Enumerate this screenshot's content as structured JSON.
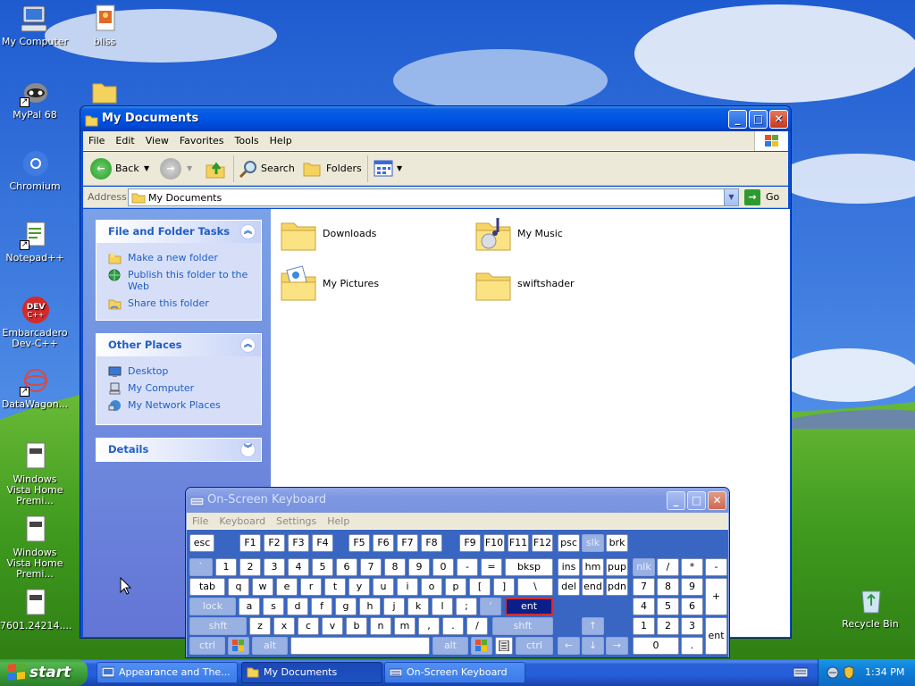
{
  "desktop": {
    "icons": [
      {
        "label": "My Computer"
      },
      {
        "label": "bliss"
      },
      {
        "label": "MyPal 68"
      },
      {
        "label": "Chromium"
      },
      {
        "label": "Notepad++"
      },
      {
        "label": "Embarcadero Dev-C++"
      },
      {
        "label": "DataWagon..."
      },
      {
        "label": "Windows Vista Home Premi..."
      },
      {
        "label": "Windows Vista Home Premi..."
      },
      {
        "label": "7601.24214...."
      },
      {
        "label": "Recycle Bin"
      }
    ]
  },
  "explorer": {
    "title": "My Documents",
    "menu": [
      "File",
      "Edit",
      "View",
      "Favorites",
      "Tools",
      "Help"
    ],
    "toolbar": {
      "back": "Back",
      "search": "Search",
      "folders": "Folders"
    },
    "address": {
      "label": "Address",
      "value": "My Documents",
      "go": "Go"
    },
    "tasks": {
      "header": "File and Folder Tasks",
      "links": [
        "Make a new folder",
        "Publish this folder to the Web",
        "Share this folder"
      ]
    },
    "other_places": {
      "header": "Other Places",
      "links": [
        "Desktop",
        "My Computer",
        "My Network Places"
      ]
    },
    "details": {
      "header": "Details"
    },
    "files": [
      {
        "name": "Downloads",
        "type": "folder"
      },
      {
        "name": "My Music",
        "type": "music-folder"
      },
      {
        "name": "My Pictures",
        "type": "pictures-folder"
      },
      {
        "name": "swiftshader",
        "type": "folder"
      }
    ]
  },
  "osk": {
    "title": "On-Screen Keyboard",
    "menu": [
      "File",
      "Keyboard",
      "Settings",
      "Help"
    ],
    "keys": {
      "esc": "esc",
      "f1": "F1",
      "f2": "F2",
      "f3": "F3",
      "f4": "F4",
      "f5": "F5",
      "f6": "F6",
      "f7": "F7",
      "f8": "F8",
      "f9": "F9",
      "f10": "F10",
      "f11": "F11",
      "f12": "F12",
      "psc": "psc",
      "slk": "slk",
      "brk": "brk",
      "tick": "`",
      "d1": "1",
      "d2": "2",
      "d3": "3",
      "d4": "4",
      "d5": "5",
      "d6": "6",
      "d7": "7",
      "d8": "8",
      "d9": "9",
      "d0": "0",
      "minus": "-",
      "equals": "=",
      "bksp": "bksp",
      "ins": "ins",
      "hm": "hm",
      "pup": "pup",
      "nlk": "nlk",
      "nslash": "/",
      "nstar": "*",
      "nminus": "-",
      "tab": "tab",
      "q": "q",
      "w": "w",
      "e": "e",
      "r": "r",
      "t": "t",
      "y": "y",
      "u": "u",
      "i": "i",
      "o": "o",
      "p": "p",
      "lbr": "[",
      "rbr": "]",
      "bslash": "\\",
      "del": "del",
      "end": "end",
      "pdn": "pdn",
      "n7": "7",
      "n8": "8",
      "n9": "9",
      "nplus": "+",
      "lock": "lock",
      "a": "a",
      "s": "s",
      "d": "d",
      "f": "f",
      "g": "g",
      "h": "h",
      "j": "j",
      "k": "k",
      "l": "l",
      "semi": ";",
      "quote": "'",
      "ent": "ent",
      "n4": "4",
      "n5": "5",
      "n6": "6",
      "lshft": "shft",
      "z": "z",
      "x": "x",
      "c": "c",
      "v": "v",
      "b": "b",
      "n": "n",
      "m": "m",
      "comma": ",",
      "period": ".",
      "slash": "/",
      "rshft": "shft",
      "up": "↑",
      "n1": "1",
      "n2": "2",
      "n3": "3",
      "nent": "ent",
      "lctrl": "ctrl",
      "lalt": "alt",
      "ralt": "alt",
      "rctrl": "ctrl",
      "left": "←",
      "down": "↓",
      "right": "→",
      "n0": "0",
      "ndot": "."
    }
  },
  "taskbar": {
    "start": "start",
    "buttons": [
      {
        "label": "Appearance and The..."
      },
      {
        "label": "My Documents"
      },
      {
        "label": "On-Screen Keyboard"
      }
    ],
    "clock": "1:34 PM"
  },
  "colors": {
    "xp_blue": "#0055e5",
    "start_green": "#3a9a37",
    "taskpane_link": "#215dc6",
    "osk_bg": "#3866c2",
    "highlight_key": "#0a1f8a"
  }
}
